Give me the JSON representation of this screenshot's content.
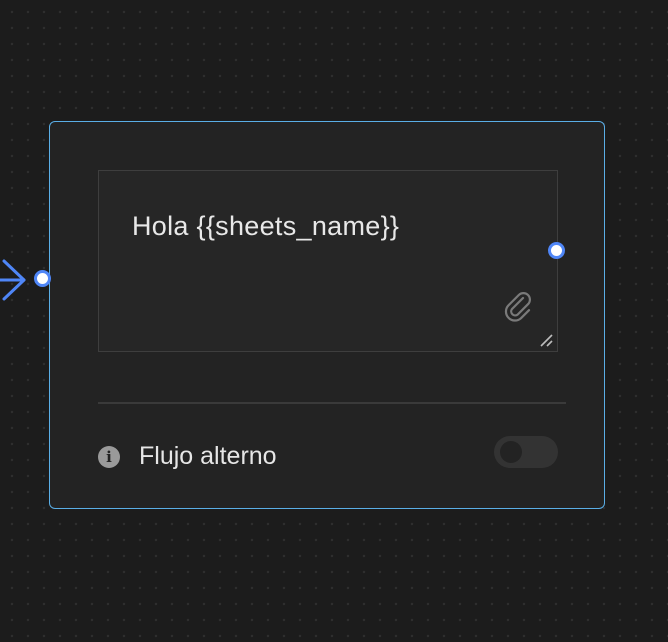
{
  "node": {
    "message_text": "Hola {{sheets_name}}",
    "alt_flow": {
      "label": "Flujo alterno",
      "enabled": false
    }
  },
  "icons": {
    "incoming": "arrow-right-icon",
    "attach": "paperclip-icon",
    "info": "info-icon",
    "resize": "resize-handle-icon"
  },
  "colors": {
    "canvas_bg": "#1c1c1c",
    "card_bg": "#232323",
    "card_border": "#5aaee6",
    "port_accent": "#4f86f7",
    "text": "#e8e8e8"
  }
}
